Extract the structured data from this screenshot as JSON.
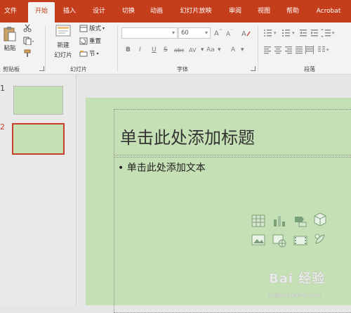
{
  "tabs": [
    "文件",
    "开始",
    "插入",
    "设计",
    "切换",
    "动画",
    "幻灯片放映",
    "审阅",
    "视图",
    "帮助",
    "Acrobat"
  ],
  "active_tab": "开始",
  "ribbon": {
    "clipboard": {
      "paste_label": "粘贴",
      "group_label": "剪贴板"
    },
    "slides": {
      "new_slide_label_1": "新建",
      "new_slide_label_2": "幻灯片",
      "layout_label": "版式",
      "reset_label": "重置",
      "section_label": "节",
      "group_label": "幻灯片"
    },
    "font": {
      "font_name": "",
      "font_size": "60",
      "group_label": "字体",
      "format_buttons": [
        "B",
        "I",
        "U",
        "S",
        "abc",
        "AV",
        "Aa",
        "A"
      ]
    },
    "paragraph": {
      "group_label": "段落"
    }
  },
  "thumbnails": [
    {
      "number": "1"
    },
    {
      "number": "2"
    }
  ],
  "slide": {
    "title_placeholder": "单击此处添加标题",
    "body_placeholder": "• 单击此处添加文本",
    "background_color": "#c5e0b4",
    "content_icons": [
      "table-icon",
      "chart-icon",
      "smartart-icon",
      "3d-model-icon",
      "picture-icon",
      "online-picture-icon",
      "video-icon",
      "icons-icon"
    ]
  },
  "watermark": {
    "main": "Bai 经验",
    "sub": "jingyan.baidu.com"
  },
  "colors": {
    "accent": "#c43e1c",
    "thumb_selected": "#c8402a"
  }
}
